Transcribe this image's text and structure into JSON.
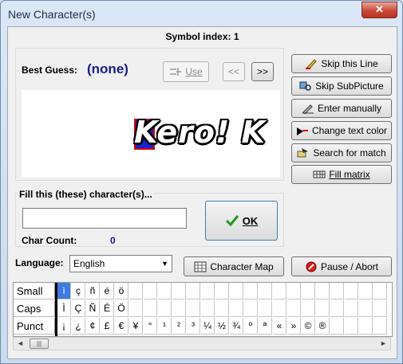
{
  "window": {
    "title": "New Character(s)",
    "close_label": "✕"
  },
  "header": {
    "symbol_index": "Symbol index: 1"
  },
  "guess": {
    "label": "Best Guess:",
    "value": "(none)",
    "use_label": "Use",
    "prev_label": "<<",
    "next_label": ">>"
  },
  "preview": {
    "text": "Kero! K"
  },
  "actions": [
    {
      "label": "Skip this Line",
      "icon": "pen-skip-icon"
    },
    {
      "label": "Skip SubPicture",
      "icon": "subpicture-icon"
    },
    {
      "label": "Enter manually",
      "icon": "keyboard-icon"
    },
    {
      "label": "Change text color",
      "icon": "color-swap-icon"
    },
    {
      "label": "Search for match",
      "icon": "search-match-icon"
    },
    {
      "label": "Fill matrix",
      "icon": "matrix-icon"
    }
  ],
  "fill": {
    "label": "Fill this (these) character(s)...",
    "value": "",
    "ok_label": "OK",
    "char_count_label": "Char Count:",
    "char_count_value": "0"
  },
  "language": {
    "label": "Language:",
    "selected": "English",
    "charmap_label": "Character Map",
    "pause_label": "Pause / Abort"
  },
  "charset": {
    "rows": [
      {
        "name": "Small",
        "chars": [
          "ì",
          "ç",
          "ñ",
          "é",
          "ö",
          "",
          "",
          "",
          "",
          "",
          "",
          "",
          "",
          "",
          "",
          "",
          "",
          "",
          "",
          "",
          "",
          "",
          ""
        ]
      },
      {
        "name": "Caps",
        "chars": [
          "Ì",
          "Ç",
          "Ñ",
          "É",
          "Ö",
          "",
          "",
          "",
          "",
          "",
          "",
          "",
          "",
          "",
          "",
          "",
          "",
          "",
          "",
          "",
          "",
          "",
          ""
        ]
      },
      {
        "name": "Punct",
        "chars": [
          "¡",
          "¿",
          "¢",
          "£",
          "€",
          "¥",
          "°",
          "¹",
          "²",
          "³",
          "¼",
          "½",
          "¾",
          "º",
          "ª",
          "«",
          "»",
          "©",
          "®",
          "",
          "",
          "",
          ""
        ]
      }
    ]
  },
  "colors": {
    "accent": "#3c7ce0",
    "guess_text": "#1c1c8c",
    "count_text": "#1c1c8c"
  }
}
